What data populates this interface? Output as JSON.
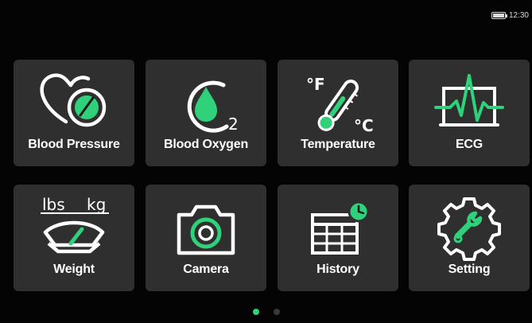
{
  "status": {
    "time": "12:30",
    "battery_level": 1.0
  },
  "colors": {
    "accent": "#2fd27a",
    "tile": "#2f2f2f",
    "background": "#040404"
  },
  "tiles": [
    {
      "label": "Blood Pressure",
      "icon": "heart-gauge-icon"
    },
    {
      "label": "Blood Oxygen",
      "icon": "oxygen-drop-icon"
    },
    {
      "label": "Temperature",
      "icon": "thermometer-icon"
    },
    {
      "label": "ECG",
      "icon": "ecg-monitor-icon"
    },
    {
      "label": "Weight",
      "icon": "scale-icon"
    },
    {
      "label": "Camera",
      "icon": "camera-icon"
    },
    {
      "label": "History",
      "icon": "calendar-clock-icon"
    },
    {
      "label": "Setting",
      "icon": "gear-wrench-icon"
    }
  ],
  "icon_text": {
    "oxygen_subscript": "2",
    "fahrenheit": "°F",
    "celsius": "°C",
    "weight_unit_1": "lbs",
    "weight_unit_2": "kg"
  },
  "pagination": {
    "pages": 2,
    "current": 1
  }
}
